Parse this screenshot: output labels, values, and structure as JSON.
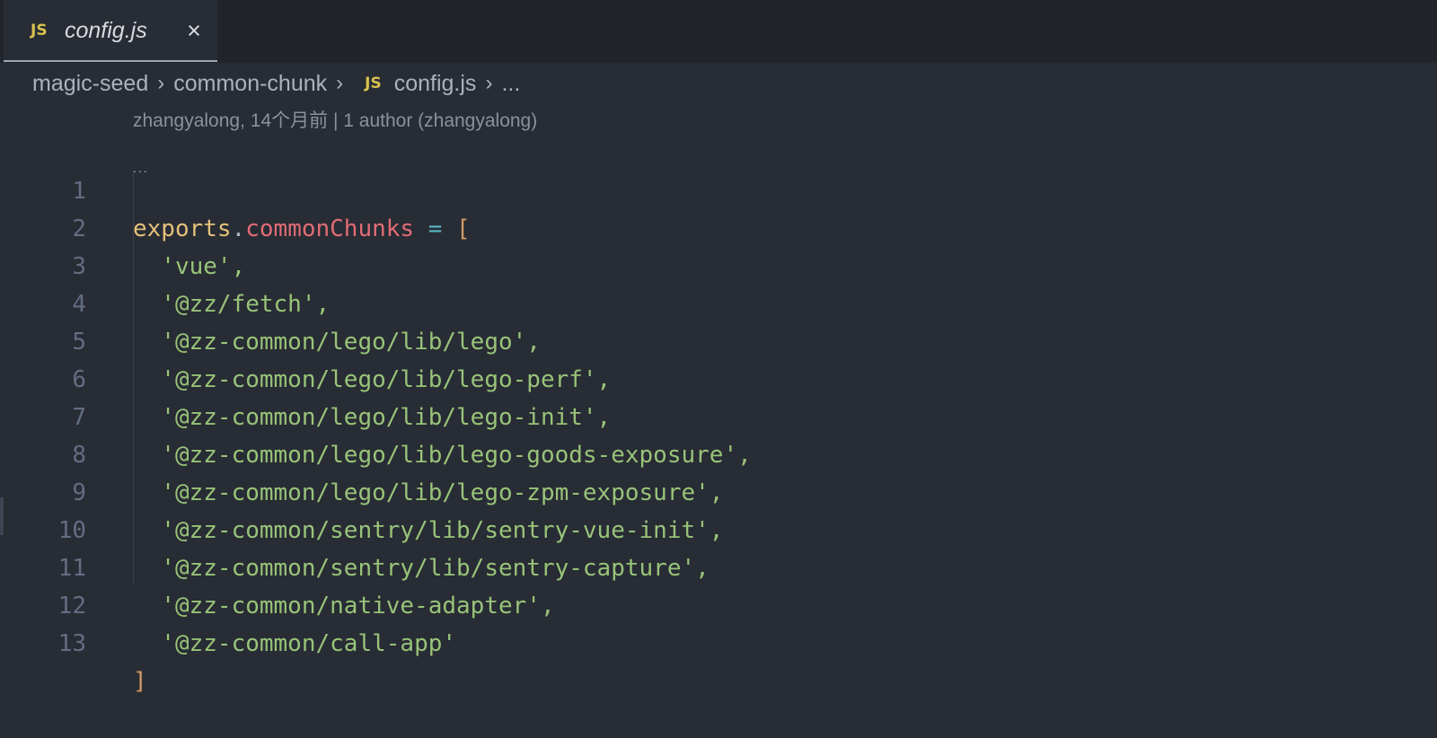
{
  "tab": {
    "icon": "JS",
    "label": "config.js",
    "close_icon": "close-icon"
  },
  "breadcrumb": {
    "items": [
      "magic-seed",
      "common-chunk",
      "config.js",
      "..."
    ],
    "file_icon": "JS"
  },
  "blame": "zhangyalong, 14个月前 | 1 author (zhangyalong)",
  "code": {
    "line_numbers": [
      "1",
      "2",
      "3",
      "4",
      "5",
      "6",
      "7",
      "8",
      "9",
      "10",
      "11",
      "12",
      "13"
    ],
    "line1": {
      "var": "exports",
      "dot": ".",
      "prop": "commonChunks",
      "op": " = ",
      "bracket": "["
    },
    "strings": [
      "  'vue',",
      "  '@zz/fetch',",
      "  '@zz-common/lego/lib/lego',",
      "  '@zz-common/lego/lib/lego-perf',",
      "  '@zz-common/lego/lib/lego-init',",
      "  '@zz-common/lego/lib/lego-goods-exposure',",
      "  '@zz-common/lego/lib/lego-zpm-exposure',",
      "  '@zz-common/sentry/lib/sentry-vue-init',",
      "  '@zz-common/sentry/lib/sentry-capture',",
      "  '@zz-common/native-adapter',",
      "  '@zz-common/call-app'"
    ],
    "closing": "]"
  },
  "colors": {
    "background": "#282c34",
    "tabbar": "#21252b",
    "string": "#98c379",
    "variable": "#e5c07b",
    "property": "#e06c75",
    "operator": "#56b6c2",
    "bracket": "#d19a66",
    "line_number": "#636d83",
    "js_badge": "#d8c14f"
  }
}
